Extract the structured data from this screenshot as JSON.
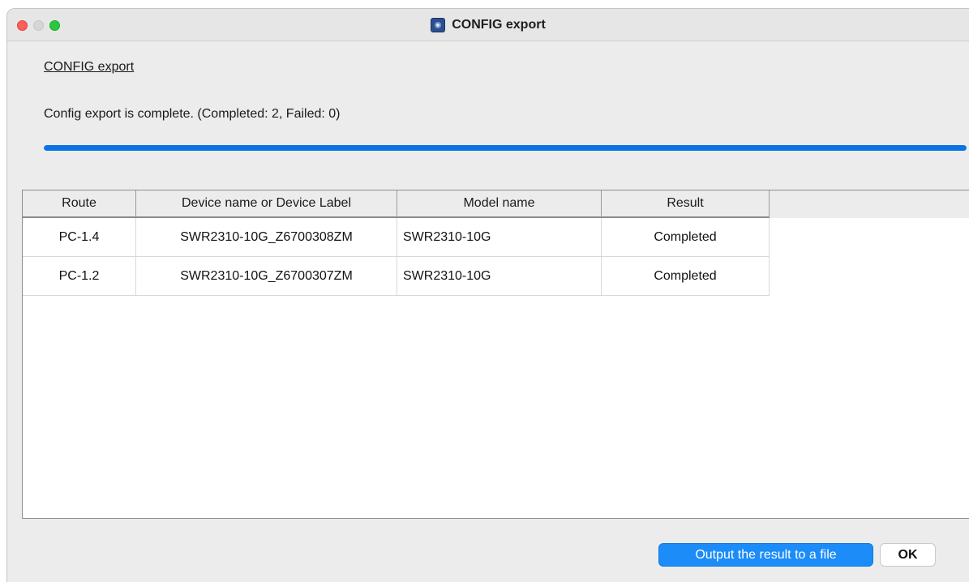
{
  "window": {
    "title": "CONFIG export"
  },
  "content": {
    "heading": "CONFIG export",
    "status": "Config export is complete. (Completed: 2, Failed: 0)",
    "progress_fraction": 1.0
  },
  "table": {
    "columns": [
      "Route",
      "Device name or Device Label",
      "Model name",
      "Result"
    ],
    "rows": [
      [
        "PC-1.4",
        "SWR2310-10G_Z6700308ZM",
        "SWR2310-10G",
        "Completed"
      ],
      [
        "PC-1.2",
        "SWR2310-10G_Z6700307ZM",
        "SWR2310-10G",
        "Completed"
      ]
    ]
  },
  "buttons": {
    "output_label": "Output the result to a file",
    "ok_label": "OK"
  },
  "colors": {
    "accent": "#1b8cf8",
    "progress": "#0a74e5",
    "close": "#fe5f57",
    "maximize": "#28c840"
  }
}
